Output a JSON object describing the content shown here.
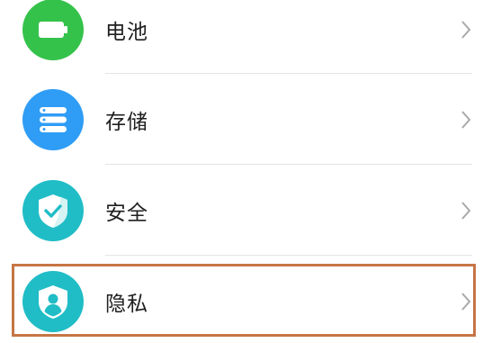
{
  "settings_list": {
    "items": [
      {
        "label": "电池",
        "icon": "battery-icon",
        "icon_color": "#35c24b"
      },
      {
        "label": "存储",
        "icon": "storage-icon",
        "icon_color": "#2f9df5"
      },
      {
        "label": "安全",
        "icon": "security-shield-icon",
        "icon_color": "#20bdc6"
      },
      {
        "label": "隐私",
        "icon": "privacy-icon",
        "icon_color": "#20bdc6"
      }
    ],
    "highlighted_item": "隐私",
    "highlight_color": "#c67545",
    "chevron_icon": "chevron-right-icon"
  }
}
